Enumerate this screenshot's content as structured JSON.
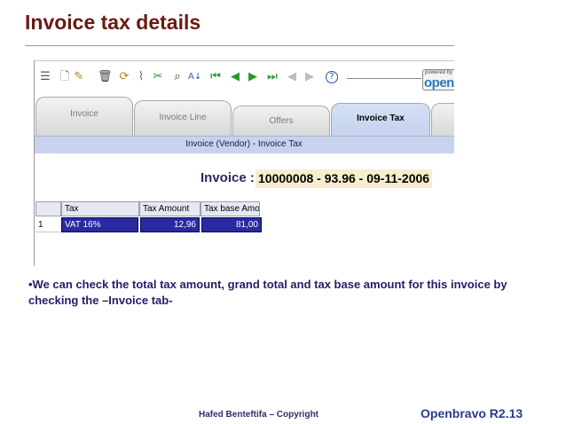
{
  "slide": {
    "title": "Invoice tax details",
    "bullet": "•We can check the total tax amount, grand total and tax base amount for this invoice by checking the –Invoice tab-",
    "footer_copyright": "Hafed Benteftifa – Copyright",
    "footer_brand": "Openbravo R2.13"
  },
  "toolbar": {
    "icons": [
      "tree-icon",
      "new-record-icon",
      "edit-icon",
      "delete-icon",
      "refresh-icon",
      "attachment-icon",
      "cut-icon",
      "search-icon",
      "sort-icon",
      "first-record-icon",
      "previous-record-icon",
      "next-record-icon",
      "last-record-icon",
      "previous-page-icon",
      "next-page-icon",
      "help-icon"
    ],
    "logo_small": "powered by",
    "logo_big": "open"
  },
  "tabs": [
    {
      "label": "Invoice",
      "active": false
    },
    {
      "label": "Invoice Line",
      "active": false
    },
    {
      "label": "Offers",
      "active": false
    },
    {
      "label": "Invoice Tax",
      "active": true
    }
  ],
  "section_title": "Invoice (Vendor) - Invoice Tax",
  "invoice": {
    "label": "Invoice :",
    "value": "10000008 - 93.96 - 09-11-2006"
  },
  "grid": {
    "columns": [
      "Tax",
      "Tax Amount",
      "Tax base Amo"
    ],
    "rows": [
      {
        "num": "1",
        "tax": "VAT 16%",
        "tax_amount": "12,96",
        "tax_base": "81,00"
      }
    ]
  },
  "colors": {
    "title": "#6b1a12",
    "selection": "#2a2aa0",
    "section_bar": "#c8d2ec",
    "invoice_highlight": "#f6eecf"
  }
}
